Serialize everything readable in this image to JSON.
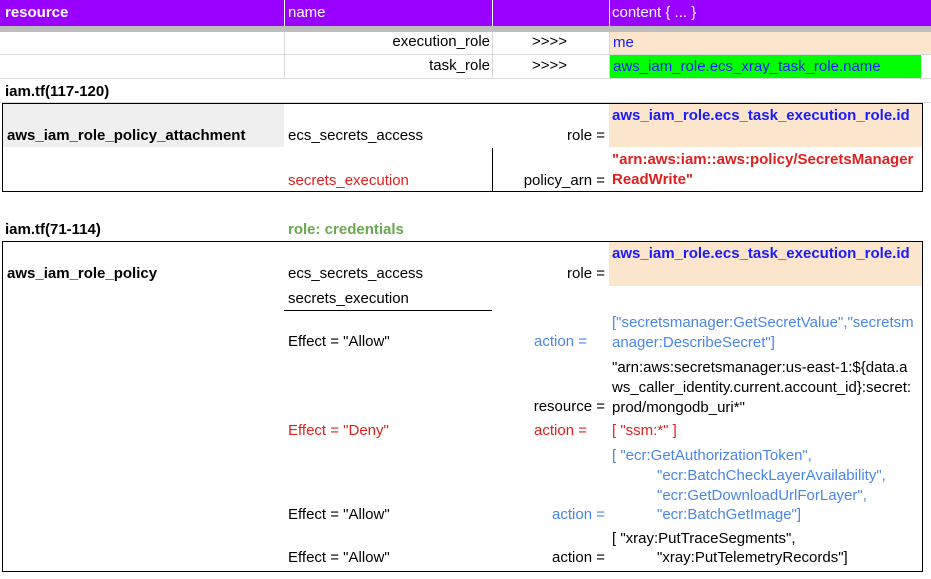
{
  "header": {
    "col_resource": "resource",
    "col_name": "name",
    "col_content": "content { ... }"
  },
  "top_rows": [
    {
      "name": "execution_role",
      "arrow": ">>>>",
      "content": "me"
    },
    {
      "name": "task_role",
      "arrow": ">>>>",
      "content": "aws_iam_role.ecs_xray_task_role.name"
    }
  ],
  "section1": {
    "file": "iam.tf(117-120)",
    "resource": "aws_iam_role_policy_attachment",
    "name1": "ecs_secrets_access",
    "name2": "secrets_execution",
    "role_key": "role =",
    "role_value": "aws_iam_role.ecs_task_execution_role.id",
    "policy_key": "policy_arn =",
    "policy_value": "\"arn:aws:iam::aws:policy/SecretsManagerReadWrite\""
  },
  "section2": {
    "file": "iam.tf(71-114)",
    "label": "role: credentials",
    "resource": "aws_iam_role_policy",
    "name1": "ecs_secrets_access",
    "name2": "secrets_execution",
    "role_key": "role =",
    "role_value": "aws_iam_role.ecs_task_execution_role.id",
    "statements": [
      {
        "effect": "Effect = \"Allow\"",
        "key": "action =",
        "value": "[\"secretsmanager:GetSecretValue\",\"secretsmanager:DescribeSecret\"]"
      },
      {
        "effect": "",
        "key": "resource =",
        "value": "\"arn:aws:secretsmanager:us-east-1:${data.aws_caller_identity.current.account_id}:secret:prod/mongodb_uri*\""
      },
      {
        "effect": "Effect = \"Deny\"",
        "key": "action =",
        "value": "[ \"ssm:*\" ]"
      },
      {
        "effect": "Effect = \"Allow\"",
        "key": "action =",
        "lines": [
          "[ \"ecr:GetAuthorizationToken\",",
          "\"ecr:BatchCheckLayerAvailability\",",
          "\"ecr:GetDownloadUrlForLayer\",",
          "\"ecr:BatchGetImage\"]"
        ]
      },
      {
        "effect": "Effect = \"Allow\"",
        "key": "action =",
        "lines": [
          "[  \"xray:PutTraceSegments\",",
          "\"xray:PutTelemetryRecords\"]"
        ]
      }
    ]
  },
  "colors": {
    "header_bg": "#9900ff",
    "peach": "#fce5cd",
    "lime": "#00ff00",
    "blue": "#1a1aff",
    "light_blue": "#4a86e8",
    "red": "#e02020",
    "green": "#6aa84f"
  }
}
